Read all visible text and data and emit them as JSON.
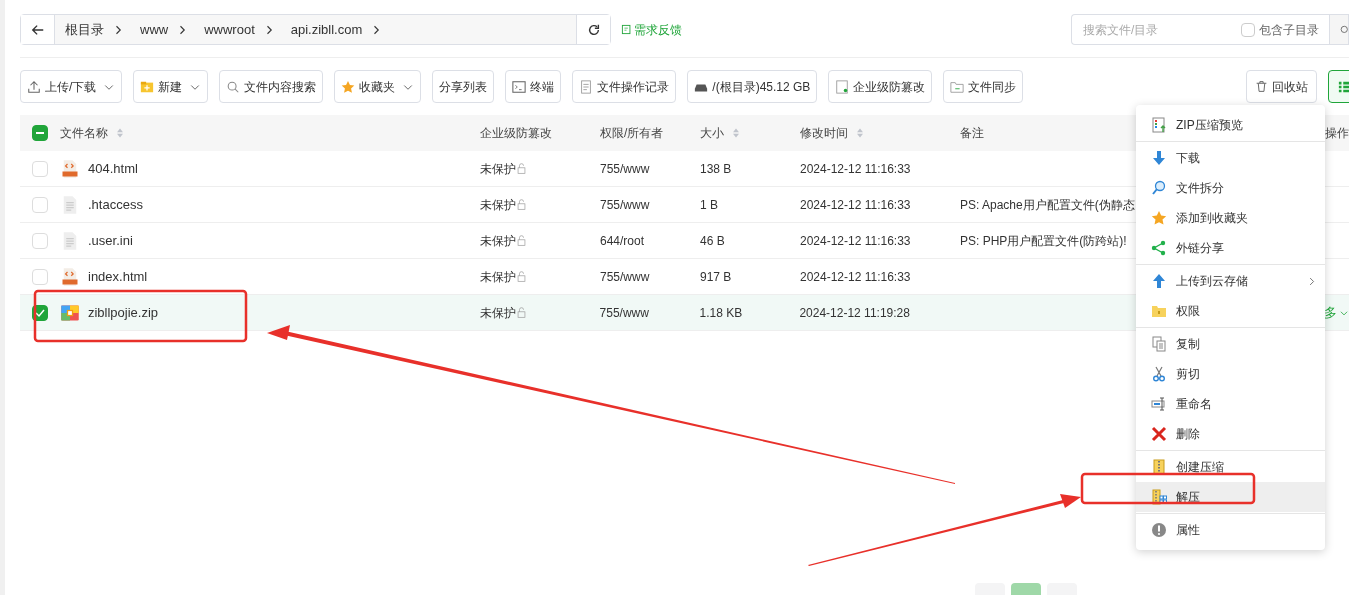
{
  "breadcrumb": {
    "segments": [
      "根目录",
      "www",
      "wwwroot",
      "api.zibll.com"
    ]
  },
  "feedback_link": "需求反馈",
  "search": {
    "placeholder": "搜索文件/目录",
    "include_subdirs": {
      "label": "包含子目录",
      "checked": false
    }
  },
  "toolbar": [
    {
      "kind": "upload",
      "label": "上传/下载",
      "dropdown": true
    },
    {
      "kind": "new",
      "label": "新建",
      "dropdown": true
    },
    {
      "kind": "search",
      "label": "文件内容搜索",
      "dropdown": false
    },
    {
      "kind": "star",
      "label": "收藏夹",
      "dropdown": true
    },
    {
      "kind": "plain",
      "label": "分享列表",
      "dropdown": false
    },
    {
      "kind": "terminal",
      "label": "终端",
      "dropdown": false
    },
    {
      "kind": "log",
      "label": "文件操作记录",
      "dropdown": false
    },
    {
      "kind": "disk",
      "label": "/(根目录)45.12 GB",
      "dropdown": false
    },
    {
      "kind": "shield",
      "label": "企业级防篡改",
      "dropdown": false
    },
    {
      "kind": "sync",
      "label": "文件同步",
      "dropdown": false
    }
  ],
  "recycle_button": "回收站",
  "table": {
    "all_partially_checked": true,
    "columns": [
      {
        "label": "文件名称",
        "sortable": true
      },
      {
        "label": "企业级防篡改",
        "sortable": false
      },
      {
        "label": "权限/所有者",
        "sortable": false
      },
      {
        "label": "大小",
        "sortable": true
      },
      {
        "label": "修改时间",
        "sortable": true
      },
      {
        "label": "备注",
        "sortable": false
      },
      {
        "label": "操作",
        "sortable": false
      }
    ],
    "rows": [
      {
        "kind": "html",
        "name": "404.html",
        "protection": "未保护",
        "permission": "755/www",
        "size": "138 B",
        "modified": "2024-12-12 11:16:33",
        "note": "",
        "selected": false
      },
      {
        "kind": "text",
        "name": ".htaccess",
        "protection": "未保护",
        "permission": "755/www",
        "size": "1 B",
        "modified": "2024-12-12 11:16:33",
        "note": "PS: Apache用户配置文件(伪静态",
        "selected": false
      },
      {
        "kind": "text",
        "name": ".user.ini",
        "protection": "未保护",
        "permission": "644/root",
        "size": "46 B",
        "modified": "2024-12-12 11:16:33",
        "note": "PS: PHP用户配置文件(防跨站)!",
        "selected": false
      },
      {
        "kind": "html",
        "name": "index.html",
        "protection": "未保护",
        "permission": "755/www",
        "size": "917 B",
        "modified": "2024-12-12 11:16:33",
        "note": "",
        "selected": false
      },
      {
        "kind": "zip",
        "name": "zibllpojie.zip",
        "protection": "未保护",
        "permission": "755/www",
        "size": "1.18 KB",
        "modified": "2024-12-12 11:19:28",
        "note": "",
        "selected": true,
        "action": "多"
      }
    ]
  },
  "context_menu": {
    "groups": [
      [
        {
          "kind": "preview",
          "label": "ZIP压缩预览",
          "highlighted": false
        }
      ],
      [
        {
          "kind": "download",
          "label": "下载",
          "highlighted": false
        },
        {
          "kind": "split",
          "label": "文件拆分",
          "highlighted": false
        },
        {
          "kind": "favorite",
          "label": "添加到收藏夹",
          "highlighted": false
        },
        {
          "kind": "share",
          "label": "外链分享",
          "highlighted": false
        }
      ],
      [
        {
          "kind": "upload",
          "label": "上传到云存储",
          "highlighted": false,
          "submenu": true
        },
        {
          "kind": "permission",
          "label": "权限",
          "highlighted": false
        }
      ],
      [
        {
          "kind": "copy",
          "label": "复制",
          "highlighted": false
        },
        {
          "kind": "cut",
          "label": "剪切",
          "highlighted": false
        },
        {
          "kind": "rename",
          "label": "重命名",
          "highlighted": false
        },
        {
          "kind": "delete",
          "label": "删除",
          "highlighted": false
        }
      ],
      [
        {
          "kind": "compress",
          "label": "创建压缩",
          "highlighted": false
        },
        {
          "kind": "extract",
          "label": "解压",
          "highlighted": true
        }
      ],
      [
        {
          "kind": "properties",
          "label": "属性",
          "highlighted": false
        }
      ]
    ]
  }
}
